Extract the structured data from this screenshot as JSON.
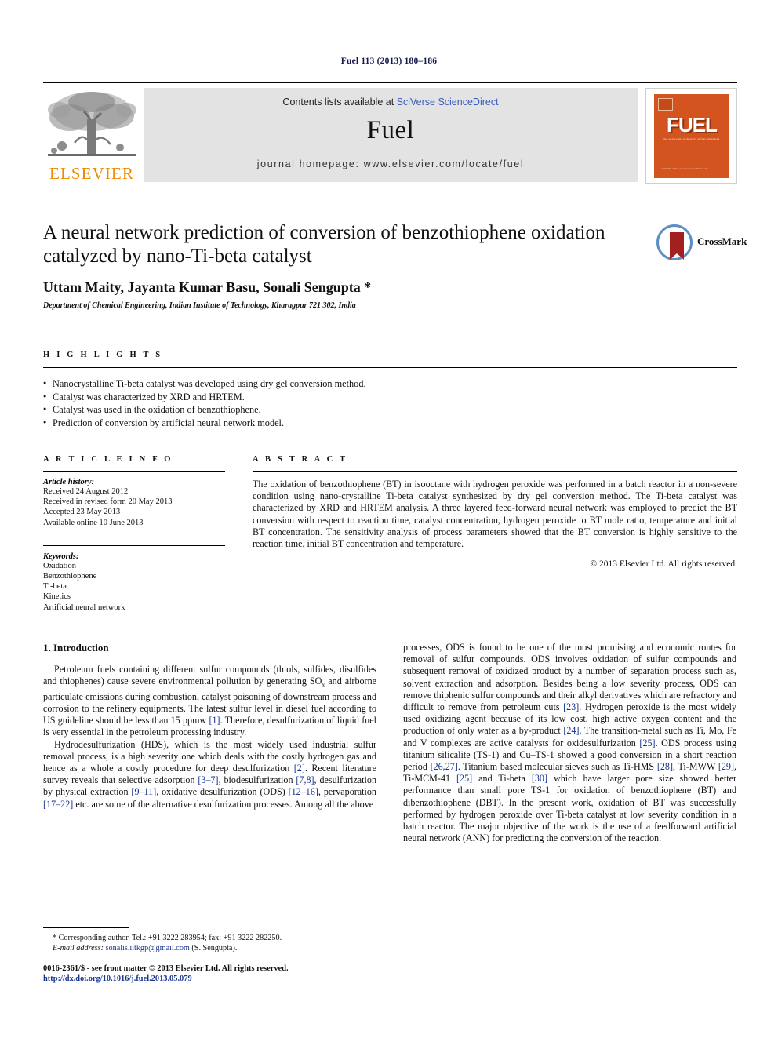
{
  "running_head": "Fuel 113 (2013) 180–186",
  "masthead": {
    "contents_prefix": "Contents lists available at ",
    "sciencedirect": "SciVerse ScienceDirect",
    "journal_name": "Fuel",
    "homepage": "journal homepage: www.elsevier.com/locate/fuel",
    "publisher_logo_text": "ELSEVIER",
    "cover": {
      "title": "FUEL",
      "subtitle": "the science and technology of fuel and energy",
      "footer": "Available online at www.sciencedirect.com"
    }
  },
  "article": {
    "title": "A neural network prediction of conversion of benzothiophene oxidation catalyzed by nano-Ti-beta catalyst",
    "authors": "Uttam Maity, Jayanta Kumar Basu, Sonali Sengupta *",
    "affiliation": "Department of Chemical Engineering, Indian Institute of Technology, Kharagpur 721 302, India",
    "crossmark_label": "CrossMark"
  },
  "highlights": {
    "heading": "H I G H L I G H T S",
    "items": [
      "Nanocrystalline Ti-beta catalyst was developed using dry gel conversion method.",
      "Catalyst was characterized by XRD and HRTEM.",
      "Catalyst was used in the oxidation of benzothiophene.",
      "Prediction of conversion by artificial neural network model."
    ]
  },
  "article_info": {
    "heading": "A R T I C L E   I N F O",
    "history_label": "Article history:",
    "history": [
      "Received 24 August 2012",
      "Received in revised form 20 May 2013",
      "Accepted 23 May 2013",
      "Available online 10 June 2013"
    ],
    "keywords_label": "Keywords:",
    "keywords": [
      "Oxidation",
      "Benzothiophene",
      "Ti-beta",
      "Kinetics",
      "Artificial neural network"
    ]
  },
  "abstract": {
    "heading": "A B S T R A C T",
    "text": "The oxidation of benzothiophene (BT) in isooctane with hydrogen peroxide was performed in a batch reactor in a non-severe condition using nano-crystalline Ti-beta catalyst synthesized by dry gel conversion method. The Ti-beta catalyst was characterized by XRD and HRTEM analysis. A three layered feed-forward neural network was employed to predict the BT conversion with respect to reaction time, catalyst concentration, hydrogen peroxide to BT mole ratio, temperature and initial BT concentration. The sensitivity analysis of process parameters showed that the BT conversion is highly sensitive to the reaction time, initial BT concentration and temperature.",
    "copyright": "© 2013 Elsevier Ltd. All rights reserved."
  },
  "introduction": {
    "heading": "1. Introduction",
    "left_paragraphs": [
      "Petroleum fuels containing different sulfur compounds (thiols, sulfides, disulfides and thiophenes) cause severe environmental pollution by generating SOx and airborne particulate emissions during combustion, catalyst poisoning of downstream process and corrosion to the refinery equipments. The latest sulfur level in diesel fuel according to US guideline should be less than 15 ppmw [1]. Therefore, desulfurization of liquid fuel is very essential in the petroleum processing industry.",
      "Hydrodesulfurization (HDS), which is the most widely used industrial sulfur removal process, is a high severity one which deals with the costly hydrogen gas and hence as a whole a costly procedure for deep desulfurization [2]. Recent literature survey reveals that selective adsorption [3–7], biodesulfurization [7,8], desulfurization by physical extraction [9–11], oxidative desulfurization (ODS) [12–16], pervaporation [17–22] etc. are some of the alternative desulfurization processes. Among all the above"
    ],
    "right_paragraphs": [
      "processes, ODS is found to be one of the most promising and economic routes for removal of sulfur compounds. ODS involves oxidation of sulfur compounds and subsequent removal of oxidized product by a number of separation process such as, solvent extraction and adsorption. Besides being a low severity process, ODS can remove thiphenic sulfur compounds and their alkyl derivatives which are refractory and difficult to remove from petroleum cuts [23]. Hydrogen peroxide is the most widely used oxidizing agent because of its low cost, high active oxygen content and the production of only water as a by-product [24]. The transition-metal such as Ti, Mo, Fe and V complexes are active catalysts for oxidesulfurization [25]. ODS process using titanium silicalite (TS-1) and Cu–TS-1 showed a good conversion in a short reaction period [26,27]. Titanium based molecular sieves such as Ti-HMS [28], Ti-MWW [29], Ti-MCM-41 [25] and Ti-beta [30] which have larger pore size showed better performance than small pore TS-1 for oxidation of benzothiophene (BT) and dibenzothiophene (DBT). In the present work, oxidation of BT was successfully performed by hydrogen peroxide over Ti-beta catalyst at low severity condition in a batch reactor. The major objective of the work is the use of a feedforward artificial neural network (ANN) for predicting the conversion of the reaction."
    ]
  },
  "footnote": {
    "corresponding": "* Corresponding author. Tel.: +91 3222 283954; fax: +91 3222 282250.",
    "email_label": "E-mail address:",
    "email": "sonalis.iitkgp@gmail.com",
    "email_suffix": "(S. Sengupta)."
  },
  "imprint": {
    "line1": "0016-2361/$ - see front matter © 2013 Elsevier Ltd. All rights reserved.",
    "doi": "http://dx.doi.org/10.1016/j.fuel.2013.05.079"
  },
  "colors": {
    "elsevier_orange": "#ed8b00",
    "link_blue": "#17348c",
    "sciencedirect_blue": "#3b5cb8",
    "masthead_grey": "#e3e3e3",
    "cover_orange": "#d4541f"
  }
}
